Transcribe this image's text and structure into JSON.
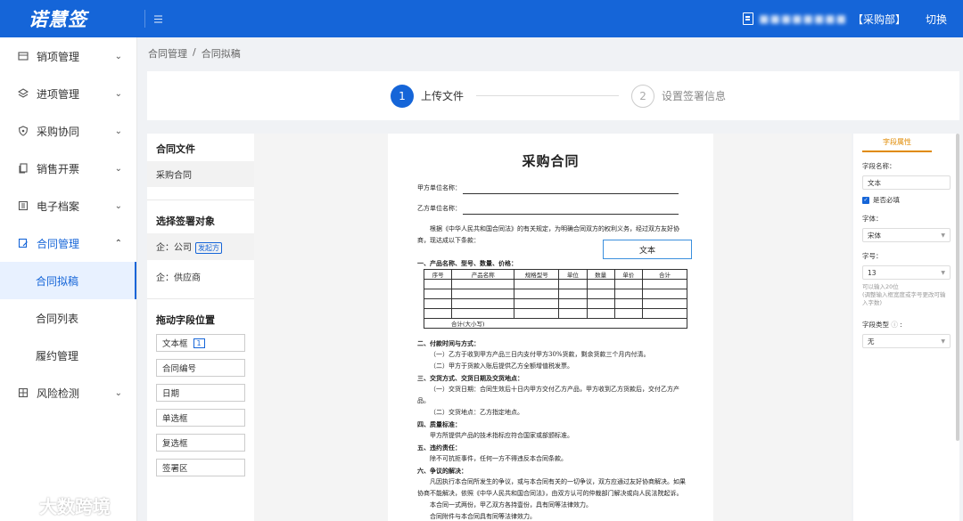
{
  "app": {
    "logo": "诺慧签",
    "user_name": "■■■■■■■■",
    "department": "【采购部】",
    "switch_label": "切换"
  },
  "sidebar": {
    "items": [
      {
        "label": "销项管理"
      },
      {
        "label": "进项管理"
      },
      {
        "label": "采购协同"
      },
      {
        "label": "销售开票"
      },
      {
        "label": "电子档案"
      },
      {
        "label": "合同管理"
      },
      {
        "label": "风险检测"
      }
    ],
    "sub_items": [
      {
        "label": "合同拟稿"
      },
      {
        "label": "合同列表"
      },
      {
        "label": "履约管理"
      }
    ]
  },
  "breadcrumb": [
    "合同管理",
    "/",
    "合同拟稿"
  ],
  "steps": [
    {
      "num": "1",
      "label": "上传文件"
    },
    {
      "num": "2",
      "label": "设置签署信息"
    }
  ],
  "left_panel": {
    "contract_files_title": "合同文件",
    "contract_file": "采购合同",
    "signers_title": "选择签署对象",
    "signer_company": "企：公司",
    "initiator_badge": "发起方",
    "signer_supplier": "企：供应商",
    "drag_title": "拖动字段位置",
    "fields": [
      "文本框",
      "合同编号",
      "日期",
      "单选框",
      "复选框",
      "签署区"
    ],
    "textbox_count": "1"
  },
  "document": {
    "title": "采购合同",
    "party_a": "甲方单位名称：",
    "party_b": "乙方单位名称：",
    "intro": "根据《中华人民共和国合同法》的有关规定，为明确合同双方的权利义务，经过双方友好协商，现达成以下条款：",
    "text_field": "文本",
    "section1": "一、产品名称、型号、数量、价格：",
    "table_headers": [
      "序号",
      "产品名称",
      "规格型号",
      "单位",
      "数量",
      "单价",
      "合计"
    ],
    "table_total": "合计(大小写)",
    "section2": "二、付款时间与方式：",
    "s2_l1": "（一）乙方于收到甲方产品三日内支付甲方30%货款，剩余货款三个月内付清。",
    "s2_l2": "（二）甲方于货款入账后提供乙方全额增值税发票。",
    "section3": "三、交货方式、交货日期及交货地点：",
    "s3_l1": "（一）交货日期：合同生效后十日内甲方交付乙方产品，甲方收到乙方货款后，交付乙方产品。",
    "s3_l2": "（二）交货地点：乙方指定地点。",
    "section4": "四、质量标准：",
    "s4_l1": "甲方所提供产品的技术指标应符合国家或部颁标准。",
    "section5": "五、违约责任：",
    "s5_l1": "除不可抗拒事件，任何一方不得违反本合同条款。",
    "section6": "六、争议的解决：",
    "s6_l1": "凡因执行本合同所发生的争议，或与本合同有关的一切争议，双方应通过友好协商解决。如果协商不能解决，依照《中华人民共和国合同法》，由双方认可的仲裁部门解决或向人民法院起诉。",
    "s6_l2": "本合同一式两份，甲乙双方各持壹份，具有同等法律效力。",
    "s6_l3": "合同附件与本合同具有同等法律效力。"
  },
  "right_panel": {
    "tab": "字段属性",
    "field_name_label": "字段名称：",
    "field_name_value": "文本",
    "required_label": "是否必填",
    "font_label": "字体：",
    "font_value": "宋体",
    "size_label": "字号：",
    "size_value": "13",
    "hint1": "可以输入20位",
    "hint2": "(调整输入框宽度或字号更改可输入字数)",
    "type_label": "字段类型",
    "type_value": "无"
  },
  "watermark": "大数跨境"
}
